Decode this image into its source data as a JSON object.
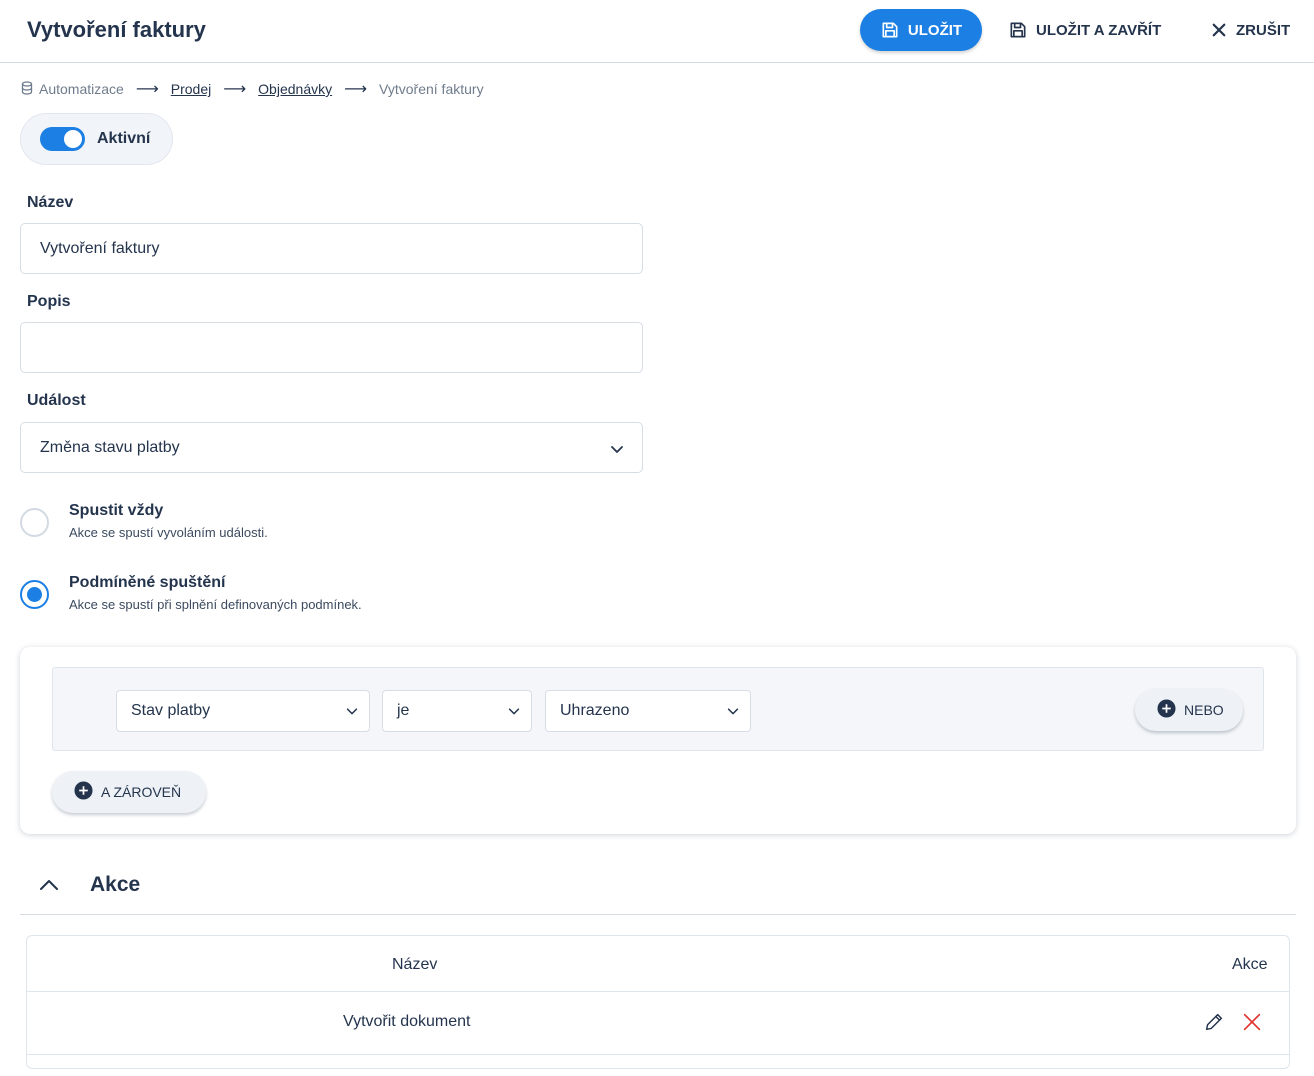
{
  "header": {
    "title": "Vytvoření faktury",
    "save_label": "ULOŽIT",
    "save_close_label": "ULOŽIT A ZAVŘÍT",
    "cancel_label": "ZRUŠIT"
  },
  "breadcrumb": {
    "items": [
      "Automatizace",
      "Prodej",
      "Objednávky",
      "Vytvoření faktury"
    ]
  },
  "active_toggle": {
    "label": "Aktivní",
    "on": true
  },
  "form": {
    "name_label": "Název",
    "name_value": "Vytvoření faktury",
    "description_label": "Popis",
    "description_value": "",
    "event_label": "Událost",
    "event_value": "Změna stavu platby"
  },
  "run_mode": {
    "always_title": "Spustit vždy",
    "always_desc": "Akce se spustí vyvoláním události.",
    "conditional_title": "Podmíněné spuštění",
    "conditional_desc": "Akce se spustí při splnění definovaných podmínek.",
    "selected": "conditional"
  },
  "condition": {
    "field": "Stav platby",
    "operator": "je",
    "value": "Uhrazeno",
    "or_label": "NEBO",
    "and_label": "A ZÁROVEŇ"
  },
  "actions": {
    "title": "Akce",
    "columns": [
      "Název",
      "Akce"
    ],
    "rows": [
      {
        "name": "Vytvořit dokument"
      }
    ]
  },
  "colors": {
    "accent": "#1c7fe3",
    "text": "#24344d",
    "danger": "#e0312c"
  }
}
